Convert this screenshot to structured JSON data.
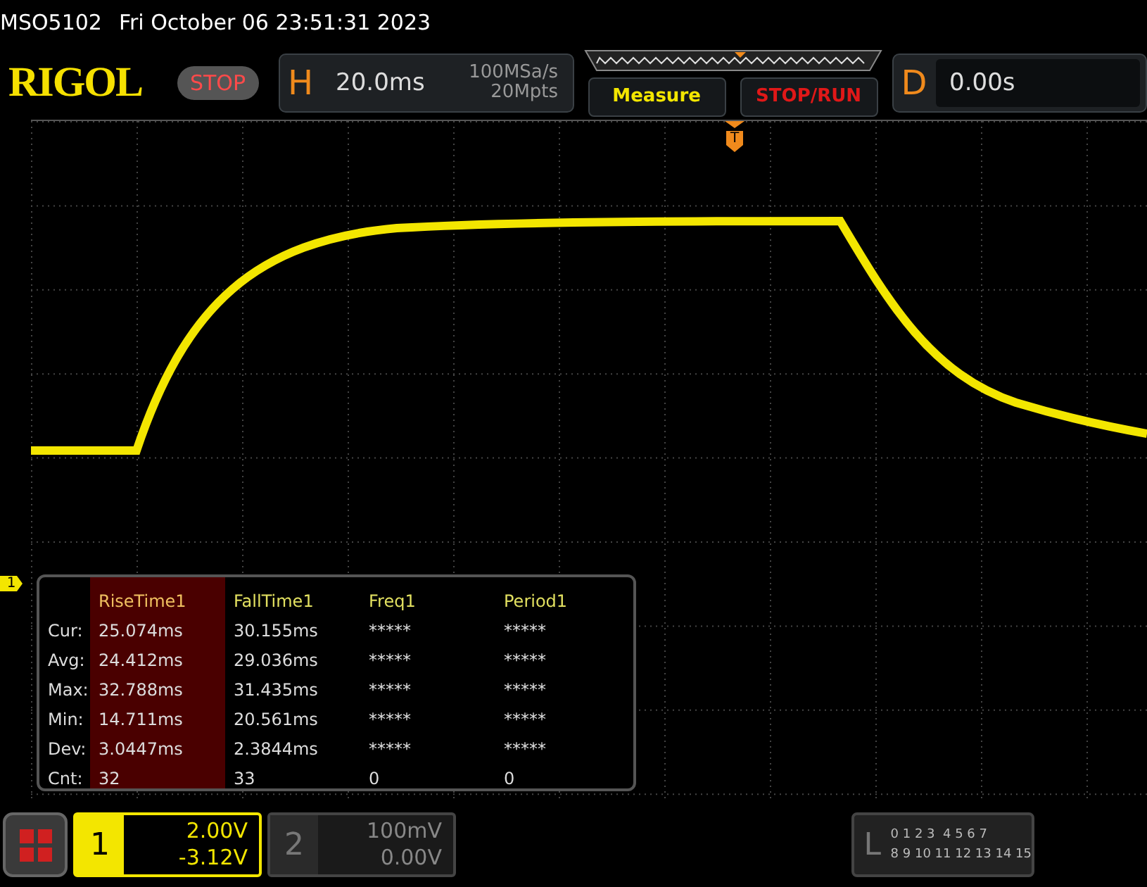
{
  "status_line": {
    "model": "MSO5102",
    "datetime": "Fri October 06 23:51:31 2023"
  },
  "header": {
    "logo": "RIGOL",
    "run_state": "STOP",
    "horizontal": {
      "letter": "H",
      "timebase": "20.0ms",
      "sample_rate": "100MSa/s",
      "memory": "20Mpts"
    },
    "buttons": [
      {
        "label": "Measure",
        "kind": "menu"
      },
      {
        "label": "STOP/RUN",
        "kind": "run"
      }
    ],
    "delay": {
      "letter": "D",
      "value": "0.00s"
    }
  },
  "trigger_marker": "T",
  "channel_marker": "1",
  "measurements": {
    "columns": [
      {
        "label": "RiseTime1",
        "selected": true
      },
      {
        "label": "FallTime1",
        "selected": false
      },
      {
        "label": "Freq1",
        "selected": false
      },
      {
        "label": "Period1",
        "selected": false
      }
    ],
    "rows": [
      {
        "label": "Cur:",
        "values": [
          "25.074ms",
          "30.155ms",
          "*****",
          "*****"
        ]
      },
      {
        "label": "Avg:",
        "values": [
          "24.412ms",
          "29.036ms",
          "*****",
          "*****"
        ]
      },
      {
        "label": "Max:",
        "values": [
          "32.788ms",
          "31.435ms",
          "*****",
          "*****"
        ]
      },
      {
        "label": "Min:",
        "values": [
          "14.711ms",
          "20.561ms",
          "*****",
          "*****"
        ]
      },
      {
        "label": "Dev:",
        "values": [
          "3.0447ms",
          "2.3844ms",
          "*****",
          "*****"
        ]
      },
      {
        "label": "Cnt:",
        "values": [
          "32",
          "33",
          "0",
          "0"
        ]
      }
    ]
  },
  "channels": [
    {
      "number": "1",
      "scale": "2.00V",
      "offset": "-3.12V",
      "selected": true
    },
    {
      "number": "2",
      "scale": "100mV",
      "offset": "0.00V",
      "selected": false
    }
  ],
  "logic": {
    "letter": "L",
    "bits_low": "0 1 2 3  4 5 6 7",
    "bits_high": "8 9 10 11 12 13 14 15"
  }
}
